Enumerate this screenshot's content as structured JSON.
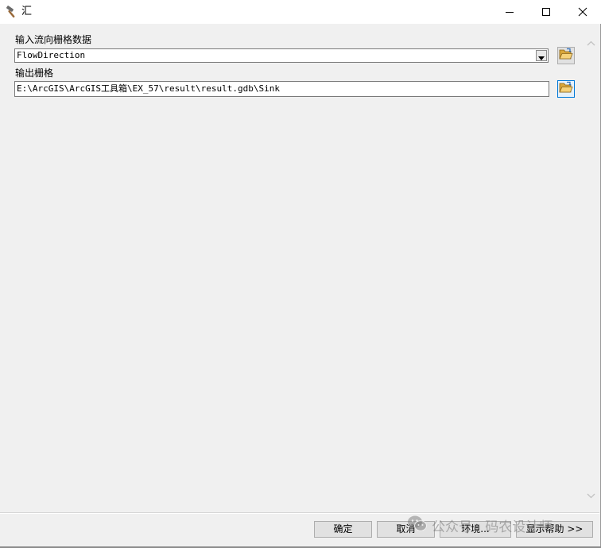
{
  "window": {
    "title": "汇",
    "icon": "hammer-icon"
  },
  "title_buttons": {
    "minimize": "minimize-icon",
    "maximize": "maximize-icon",
    "close": "close-icon"
  },
  "form": {
    "input_label": "输入流向栅格数据",
    "input_value": "FlowDirection",
    "output_label": "输出栅格",
    "output_value": "E:\\ArcGIS\\ArcGIS工具箱\\EX_57\\result\\result.gdb\\Sink"
  },
  "buttons": {
    "ok": "确定",
    "cancel": "取消",
    "environments": "环境...",
    "show_help": "显示帮助 >>"
  },
  "watermark": {
    "text": "公众号 · 码农设计师",
    "icon": "wechat-icon"
  },
  "colors": {
    "focus_blue": "#0078d7",
    "dialog_bg": "#f0f0f0",
    "folder_yellow": "#e8b84a"
  }
}
